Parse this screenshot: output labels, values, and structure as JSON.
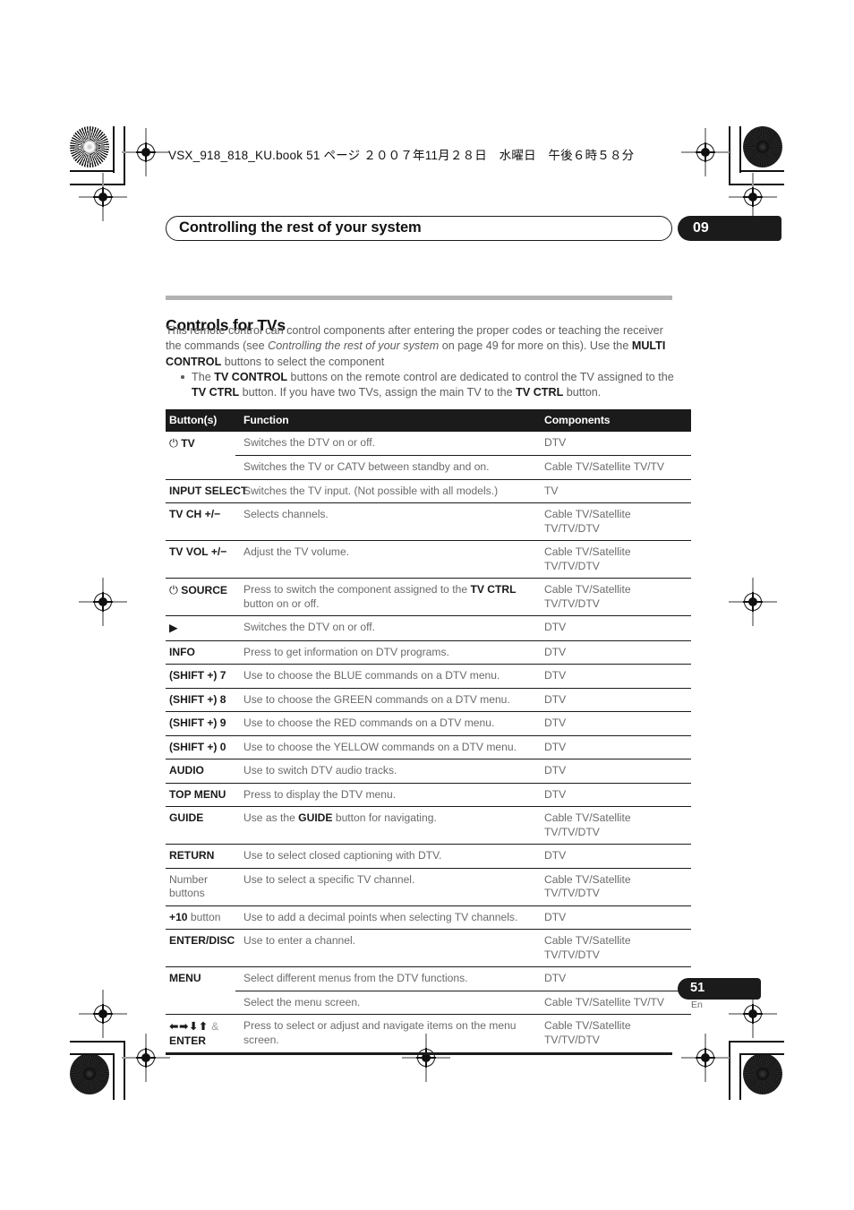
{
  "print_header": "VSX_918_818_KU.book  51 ページ  ２００７年11月２８日　水曜日　午後６時５８分",
  "chapter": {
    "title": "Controlling the rest of your system",
    "number": "09"
  },
  "section": {
    "title": "Controls for TVs",
    "intro_html": "This remote control can control components after entering the proper codes or teaching the receiver the commands (see <i>Controlling the rest of your system</i> on page 49 for more on this). Use the <b>MULTI CONTROL</b> buttons to select the component",
    "bullet_html": "The <b>TV CONTROL</b> buttons on the remote control are dedicated to control the TV assigned to the <b>TV CTRL</b> button. If you have two TVs, assign the main TV to the <b>TV CTRL</b> button."
  },
  "table": {
    "headers": {
      "buttons": "Button(s)",
      "function": "Function",
      "components": "Components"
    },
    "rows": [
      {
        "button_html": "<span class=\"pw\">&#9211;</span> TV",
        "function_html": "Switches the DTV on or off.",
        "components": "DTV",
        "rule": "full"
      },
      {
        "button_html": "",
        "function_html": "Switches the TV or CATV between standby and on.",
        "components": "Cable TV/Satellite TV/TV",
        "rule": "sub"
      },
      {
        "button_html": "INPUT SELECT",
        "function_html": "Switches the TV input. (Not possible with all models.)",
        "components": "TV",
        "rule": "full"
      },
      {
        "button_html": "TV CH +/&#8722;",
        "function_html": "Selects channels.",
        "components": "Cable TV/Satellite TV/TV/DTV",
        "rule": "full"
      },
      {
        "button_html": "TV VOL +/&#8722;",
        "function_html": "Adjust the TV volume.",
        "components": "Cable TV/Satellite TV/TV/DTV",
        "rule": "full"
      },
      {
        "button_html": "<span class=\"pw\">&#9211;</span> SOURCE",
        "function_html": "Press to switch the component assigned to the <b>TV CTRL</b> button on or off.",
        "components": "Cable TV/Satellite TV/TV/DTV",
        "rule": "full"
      },
      {
        "button_html": "<span class=\"arrows\">&#9654;</span>",
        "function_html": "Switches the DTV on or off.",
        "components": "DTV",
        "rule": "full"
      },
      {
        "button_html": "INFO",
        "function_html": "Press to get information on DTV programs.",
        "components": "DTV",
        "rule": "full"
      },
      {
        "button_html": "(SHIFT +) 7",
        "function_html": "Use to choose the BLUE commands on a DTV menu.",
        "components": "DTV",
        "rule": "full"
      },
      {
        "button_html": "(SHIFT +) 8",
        "function_html": "Use to choose the GREEN commands on a DTV menu.",
        "components": "DTV",
        "rule": "full"
      },
      {
        "button_html": "(SHIFT +) 9",
        "function_html": "Use to choose the RED commands on a DTV menu.",
        "components": "DTV",
        "rule": "full"
      },
      {
        "button_html": "(SHIFT +) 0",
        "function_html": "Use to choose the YELLOW commands on a DTV menu.",
        "components": "DTV",
        "rule": "full"
      },
      {
        "button_html": "AUDIO",
        "function_html": "Use to switch DTV audio tracks.",
        "components": "DTV",
        "rule": "full"
      },
      {
        "button_html": "TOP MENU",
        "function_html": "Press to display the DTV menu.",
        "components": "DTV",
        "rule": "full"
      },
      {
        "button_html": "GUIDE",
        "function_html": "Use as the <b>GUIDE</b> button for navigating.",
        "components": "Cable TV/Satellite TV/TV/DTV",
        "rule": "full"
      },
      {
        "button_html": "RETURN",
        "function_html": "Use to select closed captioning with DTV.",
        "components": "DTV",
        "rule": "full"
      },
      {
        "button_html": "Number<br>buttons",
        "button_light": true,
        "function_html": "Use to select a specific TV channel.",
        "components": "Cable TV/Satellite TV/TV/DTV",
        "rule": "full"
      },
      {
        "button_html": "+10 <span class=\"reg\">button</span>",
        "function_html": "Use to add a decimal points when selecting TV channels.",
        "components": "DTV",
        "rule": "full"
      },
      {
        "button_html": "ENTER/DISC",
        "function_html": "Use to enter a channel.",
        "components": "Cable TV/Satellite TV/TV/DTV",
        "rule": "full"
      },
      {
        "button_html": "MENU",
        "function_html": "Select different menus from the DTV functions.",
        "components": "DTV",
        "rule": "full"
      },
      {
        "button_html": "",
        "function_html": "Select the menu screen.",
        "components": "Cable TV/Satellite TV/TV",
        "rule": "sub"
      },
      {
        "button_html": "<span class=\"arrows\">&#11013;&#10145;&#11015;&#11014;</span> <span class=\"amp\">&amp;</span><br>ENTER",
        "function_html": "Press to select or adjust and navigate items on the menu screen.",
        "components": "Cable TV/Satellite TV/TV/DTV",
        "rule": "full"
      }
    ]
  },
  "footer": {
    "page_number": "51",
    "language": "En"
  }
}
